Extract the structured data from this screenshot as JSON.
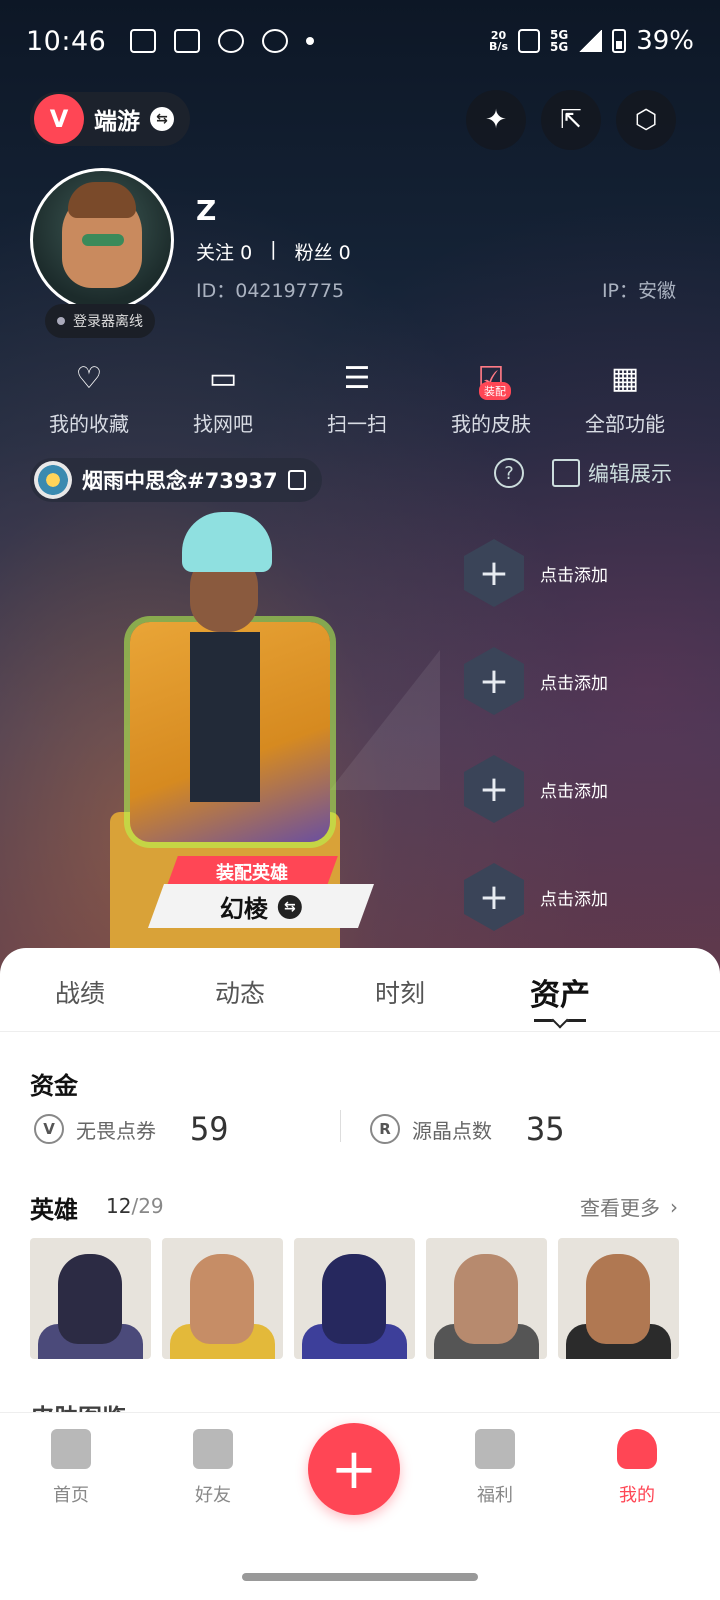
{
  "status_bar": {
    "time": "10:46",
    "net_speed_value": "20",
    "net_speed_unit": "B/s",
    "sim1": "5G",
    "sim2": "5G",
    "battery": "39%"
  },
  "header": {
    "game_logo_letter": "V",
    "game_name": "端游",
    "swap_symbol": "⇆"
  },
  "profile": {
    "username": "Z",
    "follow_label": "关注",
    "follow_count": "0",
    "separator": "|",
    "fans_label": "粉丝",
    "fans_count": "0",
    "id_text": "ID：042197775",
    "ip_text": "IP：安徽",
    "status_tag": "登录器离线"
  },
  "quick_functions": [
    {
      "label": "我的收藏",
      "icon": "heart-icon",
      "glyph": "♡"
    },
    {
      "label": "找网吧",
      "icon": "monitor-icon",
      "glyph": "▭"
    },
    {
      "label": "扫一扫",
      "icon": "scan-icon",
      "glyph": "☰"
    },
    {
      "label": "我的皮肤",
      "icon": "skin-icon",
      "glyph": "☑",
      "badge": "装配"
    },
    {
      "label": "全部功能",
      "icon": "grid-icon",
      "glyph": "▦"
    }
  ],
  "player_tag": {
    "name": "烟雨中思念#73937",
    "help_symbol": "?",
    "edit_label": "编辑展示"
  },
  "showcase": {
    "equip_label": "装配英雄",
    "hero_name": "幻棱",
    "swap_symbol": "⇆",
    "slot_label": "点击添加",
    "slot_plus": "+"
  },
  "tabs": [
    {
      "label": "战绩",
      "active": false
    },
    {
      "label": "动态",
      "active": false
    },
    {
      "label": "时刻",
      "active": false
    },
    {
      "label": "资产",
      "active": true
    }
  ],
  "assets": {
    "funds_title": "资金",
    "funds": [
      {
        "icon_letter": "V",
        "label": "无畏点券",
        "value": "59"
      },
      {
        "icon_letter": "R",
        "label": "源晶点数",
        "value": "35"
      }
    ],
    "heroes_title": "英雄",
    "heroes_owned": "12",
    "heroes_total": "/29",
    "more_label": "查看更多",
    "more_chevron": "›",
    "next_section_peek": "皮肤图鉴"
  },
  "bottom_nav": [
    {
      "label": "首页",
      "active": false
    },
    {
      "label": "好友",
      "active": false
    },
    {
      "label": "福利",
      "active": false
    },
    {
      "label": "我的",
      "active": true
    }
  ],
  "fab_symbol": "+",
  "colors": {
    "accent": "#ff4655",
    "sheet": "#ffffff",
    "text_muted": "#888888"
  }
}
